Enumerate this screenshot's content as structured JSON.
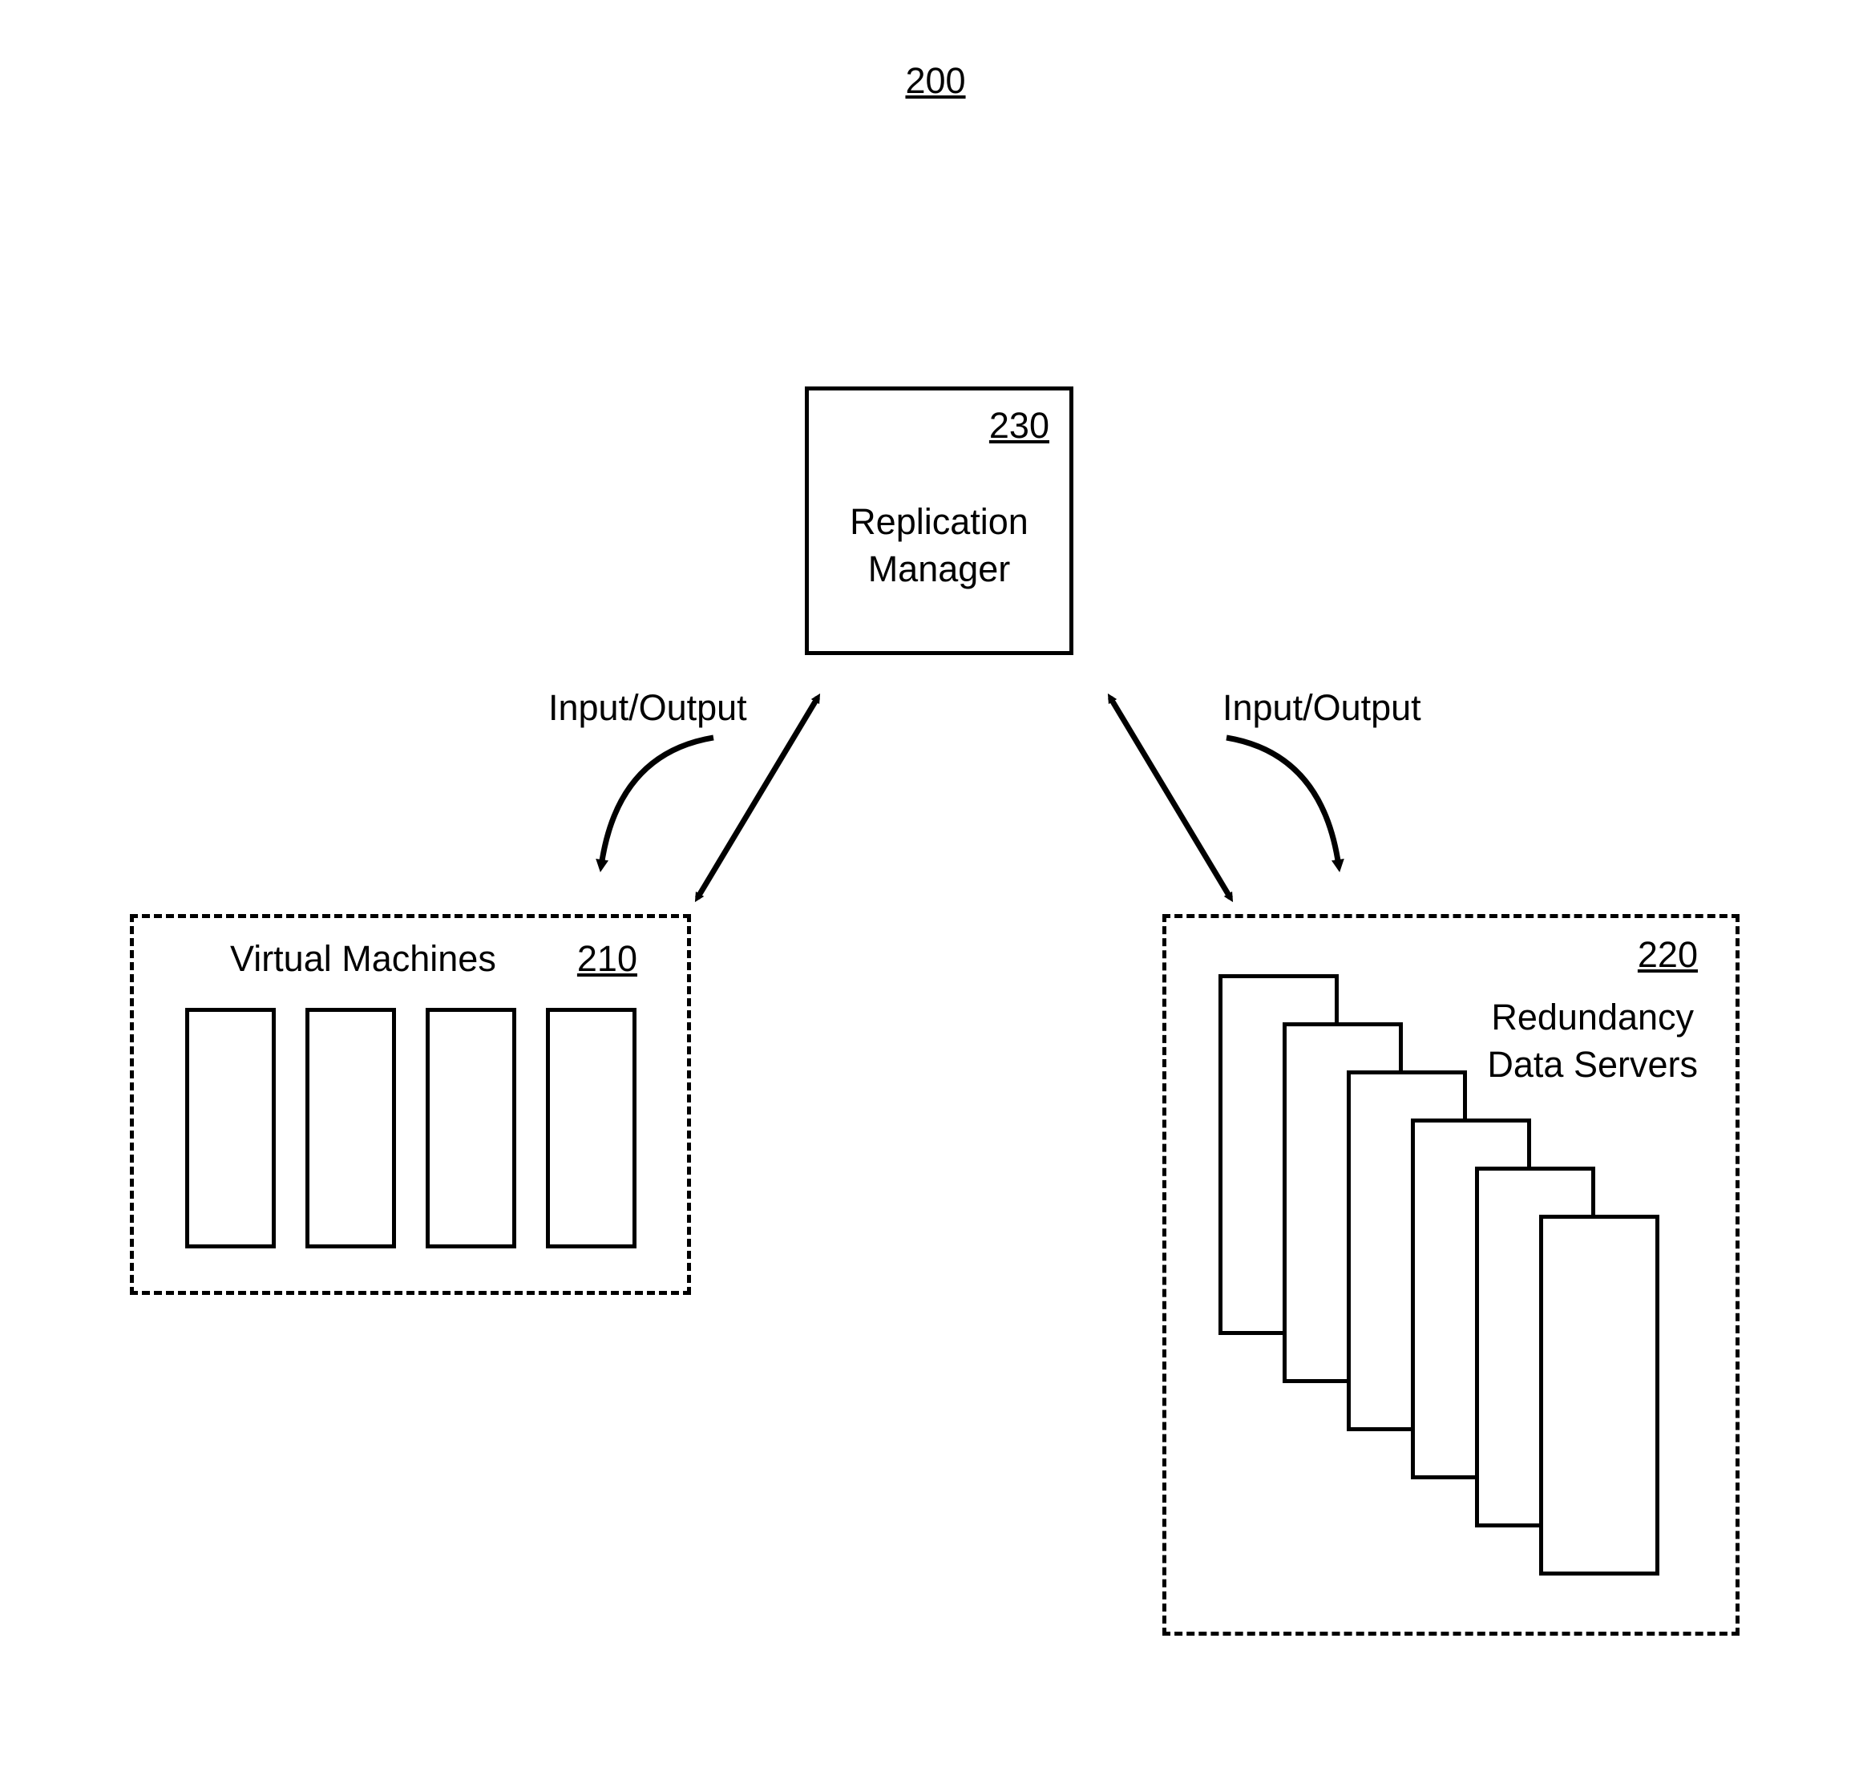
{
  "figure": {
    "reference": "200",
    "title": "200"
  },
  "replication_manager": {
    "reference": "230",
    "label": "Replication\nManager"
  },
  "virtual_machines": {
    "reference": "210",
    "title": "Virtual Machines",
    "count": 4
  },
  "redundancy_servers": {
    "reference": "220",
    "title": "Redundancy\nData Servers",
    "count": 6
  },
  "connections": {
    "left_label": "Input/Output",
    "right_label": "Input/Output"
  }
}
